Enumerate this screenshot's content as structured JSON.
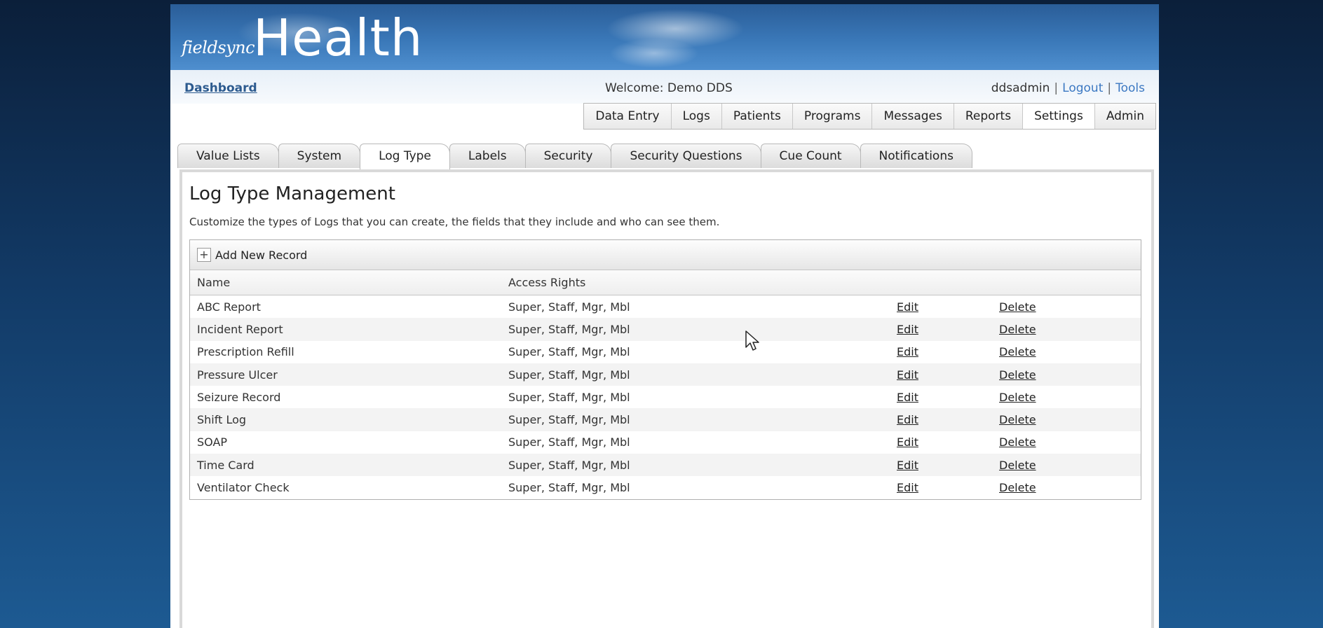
{
  "brand": {
    "small": "fieldsync",
    "big": "Health"
  },
  "subheader": {
    "dashboard": "Dashboard",
    "welcome": "Welcome: Demo DDS",
    "username": "ddsadmin",
    "logout": "Logout",
    "tools": "Tools"
  },
  "main_nav": [
    "Data Entry",
    "Logs",
    "Patients",
    "Programs",
    "Messages",
    "Reports",
    "Settings",
    "Admin"
  ],
  "settings_tabs": [
    "Value Lists",
    "System",
    "Log Type",
    "Labels",
    "Security",
    "Security Questions",
    "Cue Count",
    "Notifications"
  ],
  "page": {
    "title": "Log Type Management",
    "description": "Customize the types of Logs that you can create, the fields that they include and who can see them."
  },
  "grid": {
    "add_label": "Add New Record",
    "add_icon": "+",
    "columns": {
      "name": "Name",
      "rights": "Access Rights"
    },
    "edit_label": "Edit",
    "delete_label": "Delete",
    "rows": [
      {
        "name": "ABC Report",
        "rights": "Super, Staff, Mgr, Mbl"
      },
      {
        "name": "Incident Report",
        "rights": "Super, Staff, Mgr, Mbl"
      },
      {
        "name": "Prescription Refill",
        "rights": "Super, Staff, Mgr, Mbl"
      },
      {
        "name": "Pressure Ulcer",
        "rights": "Super, Staff, Mgr, Mbl"
      },
      {
        "name": "Seizure Record",
        "rights": "Super, Staff, Mgr, Mbl"
      },
      {
        "name": "Shift Log",
        "rights": "Super, Staff, Mgr, Mbl"
      },
      {
        "name": "SOAP",
        "rights": "Super, Staff, Mgr, Mbl"
      },
      {
        "name": "Time Card",
        "rights": "Super, Staff, Mgr, Mbl"
      },
      {
        "name": "Ventilator Check",
        "rights": "Super, Staff, Mgr, Mbl"
      }
    ]
  }
}
